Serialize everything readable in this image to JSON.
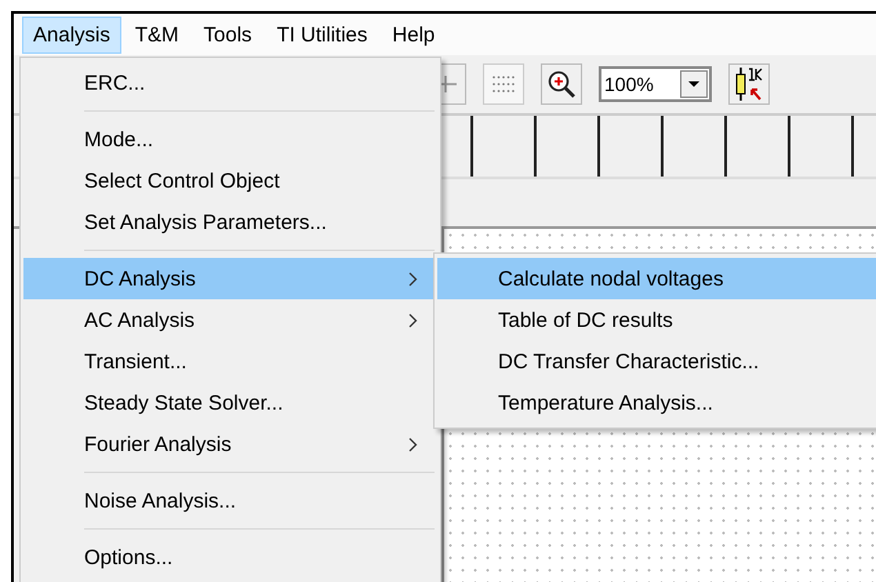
{
  "menu_bar": [
    {
      "label": "Analysis",
      "selected": true
    },
    {
      "label": "T&M",
      "selected": false
    },
    {
      "label": "Tools",
      "selected": false
    },
    {
      "label": "TI Utilities",
      "selected": false
    },
    {
      "label": "Help",
      "selected": false
    }
  ],
  "toolbar": {
    "zoom": "100%"
  },
  "menu": {
    "items": [
      {
        "kind": "item",
        "label": "ERC...",
        "selected": false,
        "has_submenu": false
      },
      {
        "kind": "separator"
      },
      {
        "kind": "item",
        "label": "Mode...",
        "selected": false,
        "has_submenu": false
      },
      {
        "kind": "item",
        "label": "Select Control Object",
        "selected": false,
        "has_submenu": false
      },
      {
        "kind": "item",
        "label": "Set Analysis Parameters...",
        "selected": false,
        "has_submenu": false
      },
      {
        "kind": "separator"
      },
      {
        "kind": "item",
        "label": "DC Analysis",
        "selected": true,
        "has_submenu": true
      },
      {
        "kind": "item",
        "label": "AC Analysis",
        "selected": false,
        "has_submenu": true
      },
      {
        "kind": "item",
        "label": "Transient...",
        "selected": false,
        "has_submenu": false
      },
      {
        "kind": "item",
        "label": "Steady State Solver...",
        "selected": false,
        "has_submenu": false
      },
      {
        "kind": "item",
        "label": "Fourier Analysis",
        "selected": false,
        "has_submenu": true
      },
      {
        "kind": "separator"
      },
      {
        "kind": "item",
        "label": "Noise Analysis...",
        "selected": false,
        "has_submenu": false
      },
      {
        "kind": "separator"
      },
      {
        "kind": "item",
        "label": "Options...",
        "selected": false,
        "has_submenu": false
      }
    ]
  },
  "submenu": {
    "items": [
      {
        "kind": "item",
        "label": "Calculate nodal voltages",
        "selected": true,
        "has_submenu": false
      },
      {
        "kind": "item",
        "label": "Table of DC results",
        "selected": false,
        "has_submenu": false
      },
      {
        "kind": "item",
        "label": "DC Transfer Characteristic...",
        "selected": false,
        "has_submenu": false
      },
      {
        "kind": "item",
        "label": "Temperature Analysis...",
        "selected": false,
        "has_submenu": false
      }
    ]
  }
}
